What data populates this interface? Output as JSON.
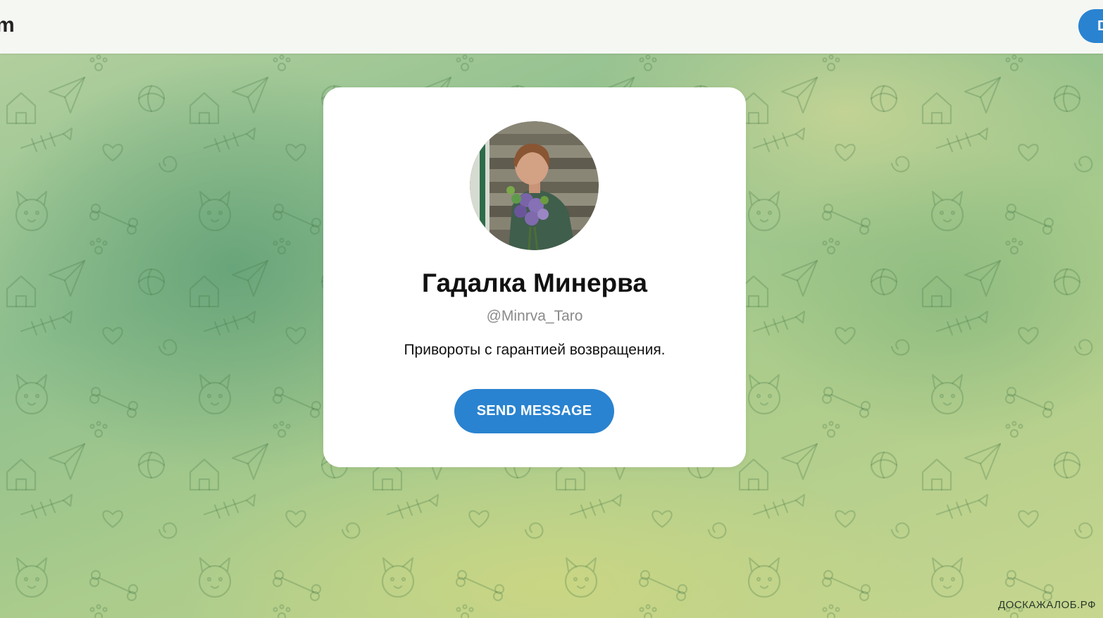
{
  "header": {
    "logo_text": "m",
    "download_button_label": "D"
  },
  "profile": {
    "name": "Гадалка Минерва",
    "username": "@Minrva_Taro",
    "description": "Привороты с гарантией возвращения.",
    "send_button_label": "SEND MESSAGE",
    "avatar": "profile-photo"
  },
  "watermark": "ДОСКАЖАЛОБ.РФ",
  "colors": {
    "accent": "#2a83d0",
    "topbar": "#f5f7f3",
    "card": "#ffffff"
  }
}
